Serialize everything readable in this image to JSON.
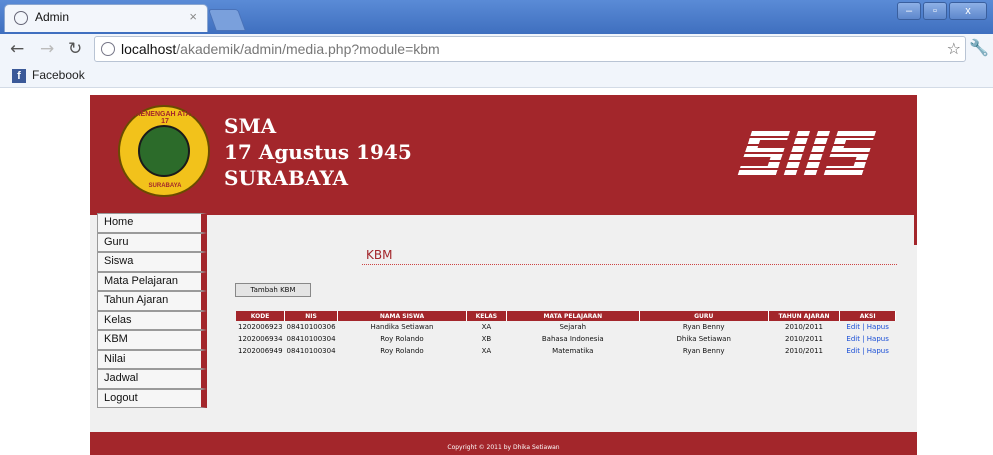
{
  "browser": {
    "tab_title": "Admin",
    "tab_close": "×",
    "url_host": "localhost",
    "url_path": "/akademik/admin/media.php?module=kbm",
    "bookmark": "Facebook",
    "bookmark_icon": "f",
    "win_minimize": "–",
    "win_maximize": "▫",
    "win_close": "x"
  },
  "school": {
    "line1": "SMA",
    "line2": "17 Agustus 1945",
    "line3": "SURABAYA",
    "logo_text_top": "MENENGAH ATAS 17",
    "logo_text_bottom": "SURABAYA",
    "brand": "SIIS"
  },
  "menu": {
    "items": [
      "Home",
      "Guru",
      "Siswa",
      "Mata Pelajaran",
      "Tahun Ajaran",
      "Kelas",
      "KBM",
      "Nilai",
      "Jadwal",
      "Logout"
    ]
  },
  "main": {
    "title": "KBM",
    "add_button": "Tambah KBM"
  },
  "table": {
    "headers": [
      "KODE",
      "NIS",
      "NAMA SISWA",
      "KELAS",
      "MATA PELAJARAN",
      "GURU",
      "TAHUN AJARAN",
      "AKSI"
    ],
    "rows": [
      {
        "kode": "1202006923",
        "nis": "08410100306",
        "nama": "Handika Setiawan",
        "kelas": "XA",
        "mapel": "Sejarah",
        "guru": "Ryan Benny",
        "tahun": "2010/2011",
        "edit": "Edit",
        "sep": " | ",
        "hapus": "Hapus"
      },
      {
        "kode": "1202006934",
        "nis": "08410100304",
        "nama": "Roy Rolando",
        "kelas": "XB",
        "mapel": "Bahasa Indonesia",
        "guru": "Dhika Setiawan",
        "tahun": "2010/2011",
        "edit": "Edit",
        "sep": " | ",
        "hapus": "Hapus"
      },
      {
        "kode": "1202006949",
        "nis": "08410100304",
        "nama": "Roy Rolando",
        "kelas": "XA",
        "mapel": "Matematika",
        "guru": "Ryan Benny",
        "tahun": "2010/2011",
        "edit": "Edit",
        "sep": " | ",
        "hapus": "Hapus"
      }
    ]
  },
  "footer": {
    "copyright": "Copyright © 2011 by Dhika Setiawan"
  },
  "colors": {
    "brand_red": "#a3262b",
    "link_blue": "#1a4fd6"
  }
}
